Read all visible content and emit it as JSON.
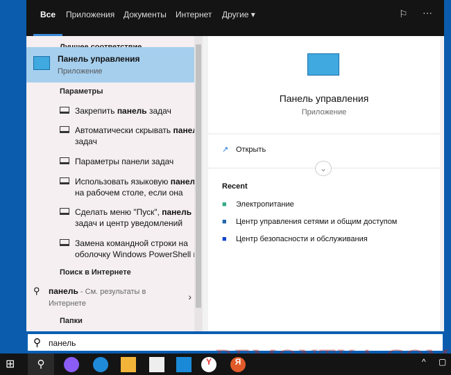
{
  "tabs": [
    "Все",
    "Приложения",
    "Документы",
    "Интернет",
    "Другие"
  ],
  "left": {
    "best_label": "Лучшее соответствие",
    "best": {
      "title": "Панель управления",
      "subtitle": "Приложение"
    },
    "params_label": "Параметры",
    "params": [
      {
        "pre": "Закрепить ",
        "bold": "панель",
        "post": " задач"
      },
      {
        "pre": "Автоматически скрывать ",
        "bold": "панель",
        "post": " задач"
      },
      {
        "pre": "Параметры панели задач",
        "bold": "",
        "post": ""
      },
      {
        "pre": "Использовать языковую ",
        "bold": "панель",
        "post": " на рабочем столе, если она"
      },
      {
        "pre": "Сделать меню \"Пуск\", ",
        "bold": "панель",
        "post": " задач и центр уведомлений"
      },
      {
        "pre": "Замена командной строки на оболочку Windows PowerShell в",
        "bold": "",
        "post": ""
      }
    ],
    "web_label": "Поиск в Интернете",
    "web": {
      "query": "панель",
      "hint": " - См. результаты в Интернете"
    },
    "folders_label": "Папки"
  },
  "right": {
    "title": "Панель управления",
    "subtitle": "Приложение",
    "open": "Открыть",
    "recent_label": "Recent",
    "recent": [
      "Электропитание",
      "Центр управления сетями и общим доступом",
      "Центр безопасности и обслуживания"
    ]
  },
  "search": {
    "value": "панель"
  },
  "watermark": "REMONTKA.COM",
  "colors": {
    "accent": "#3c8ad8",
    "highlight": "#a6cfee",
    "desktop": "#0b5cad"
  }
}
